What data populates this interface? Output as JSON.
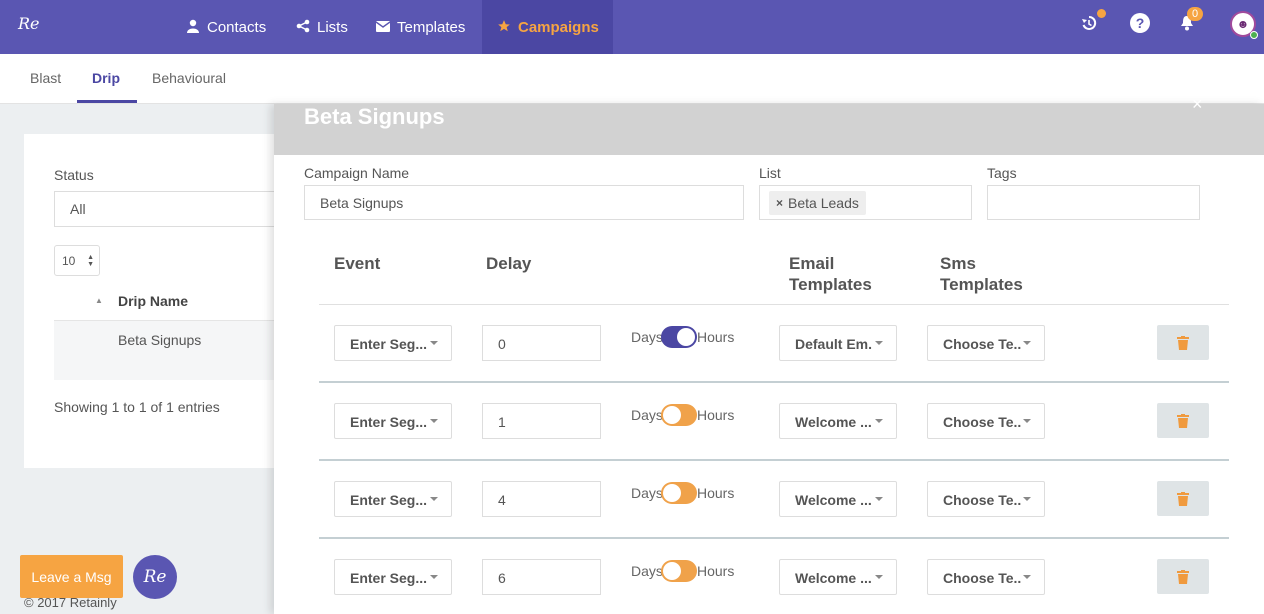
{
  "brand": {
    "logo_text": "Re",
    "primary_color": "#5a56b2",
    "accent_color": "#f6a442"
  },
  "nav": {
    "items": [
      {
        "label": "Contacts",
        "icon": "user-icon"
      },
      {
        "label": "Lists",
        "icon": "share-icon"
      },
      {
        "label": "Templates",
        "icon": "envelope-icon"
      },
      {
        "label": "Campaigns",
        "icon": "star-icon",
        "active": true
      }
    ],
    "notification_count": "0"
  },
  "subtabs": {
    "blast": "Blast",
    "drip": "Drip",
    "behavioural": "Behavioural",
    "active": "Drip"
  },
  "list_view": {
    "status_label": "Status",
    "status_value": "All",
    "page_length": "10",
    "column_header": "Drip Name",
    "rows": [
      "Beta Signups"
    ],
    "showing_text": "Showing 1 to 1 of 1 entries",
    "footer": "© 2017 Retainly"
  },
  "panel": {
    "title": "Beta Signups",
    "close_symbol": "×",
    "campaign_name_label": "Campaign Name",
    "campaign_name_value": "Beta Signups",
    "list_label": "List",
    "list_tag": "Beta Leads",
    "tags_label": "Tags",
    "columns": {
      "event": "Event",
      "delay": "Delay",
      "email_templates_1": "Email",
      "email_templates_2": "Templates",
      "sms_templates_1": "Sms",
      "sms_templates_2": "Templates"
    },
    "toggle_left": "Days",
    "toggle_right": "Hours",
    "steps": [
      {
        "event": "Enter Seg...",
        "delay": "0",
        "unit": "Hours",
        "email": "Default Em.",
        "sms": "Choose Te.."
      },
      {
        "event": "Enter Seg...",
        "delay": "1",
        "unit": "Days",
        "email": "Welcome ...",
        "sms": "Choose Te.."
      },
      {
        "event": "Enter Seg...",
        "delay": "4",
        "unit": "Days",
        "email": "Welcome ...",
        "sms": "Choose Te.."
      },
      {
        "event": "Enter Seg...",
        "delay": "6",
        "unit": "Days",
        "email": "Welcome ...",
        "sms": "Choose Te.."
      }
    ]
  },
  "chat": {
    "leave_msg": "Leave a Msg",
    "avatar_text": "Re"
  }
}
